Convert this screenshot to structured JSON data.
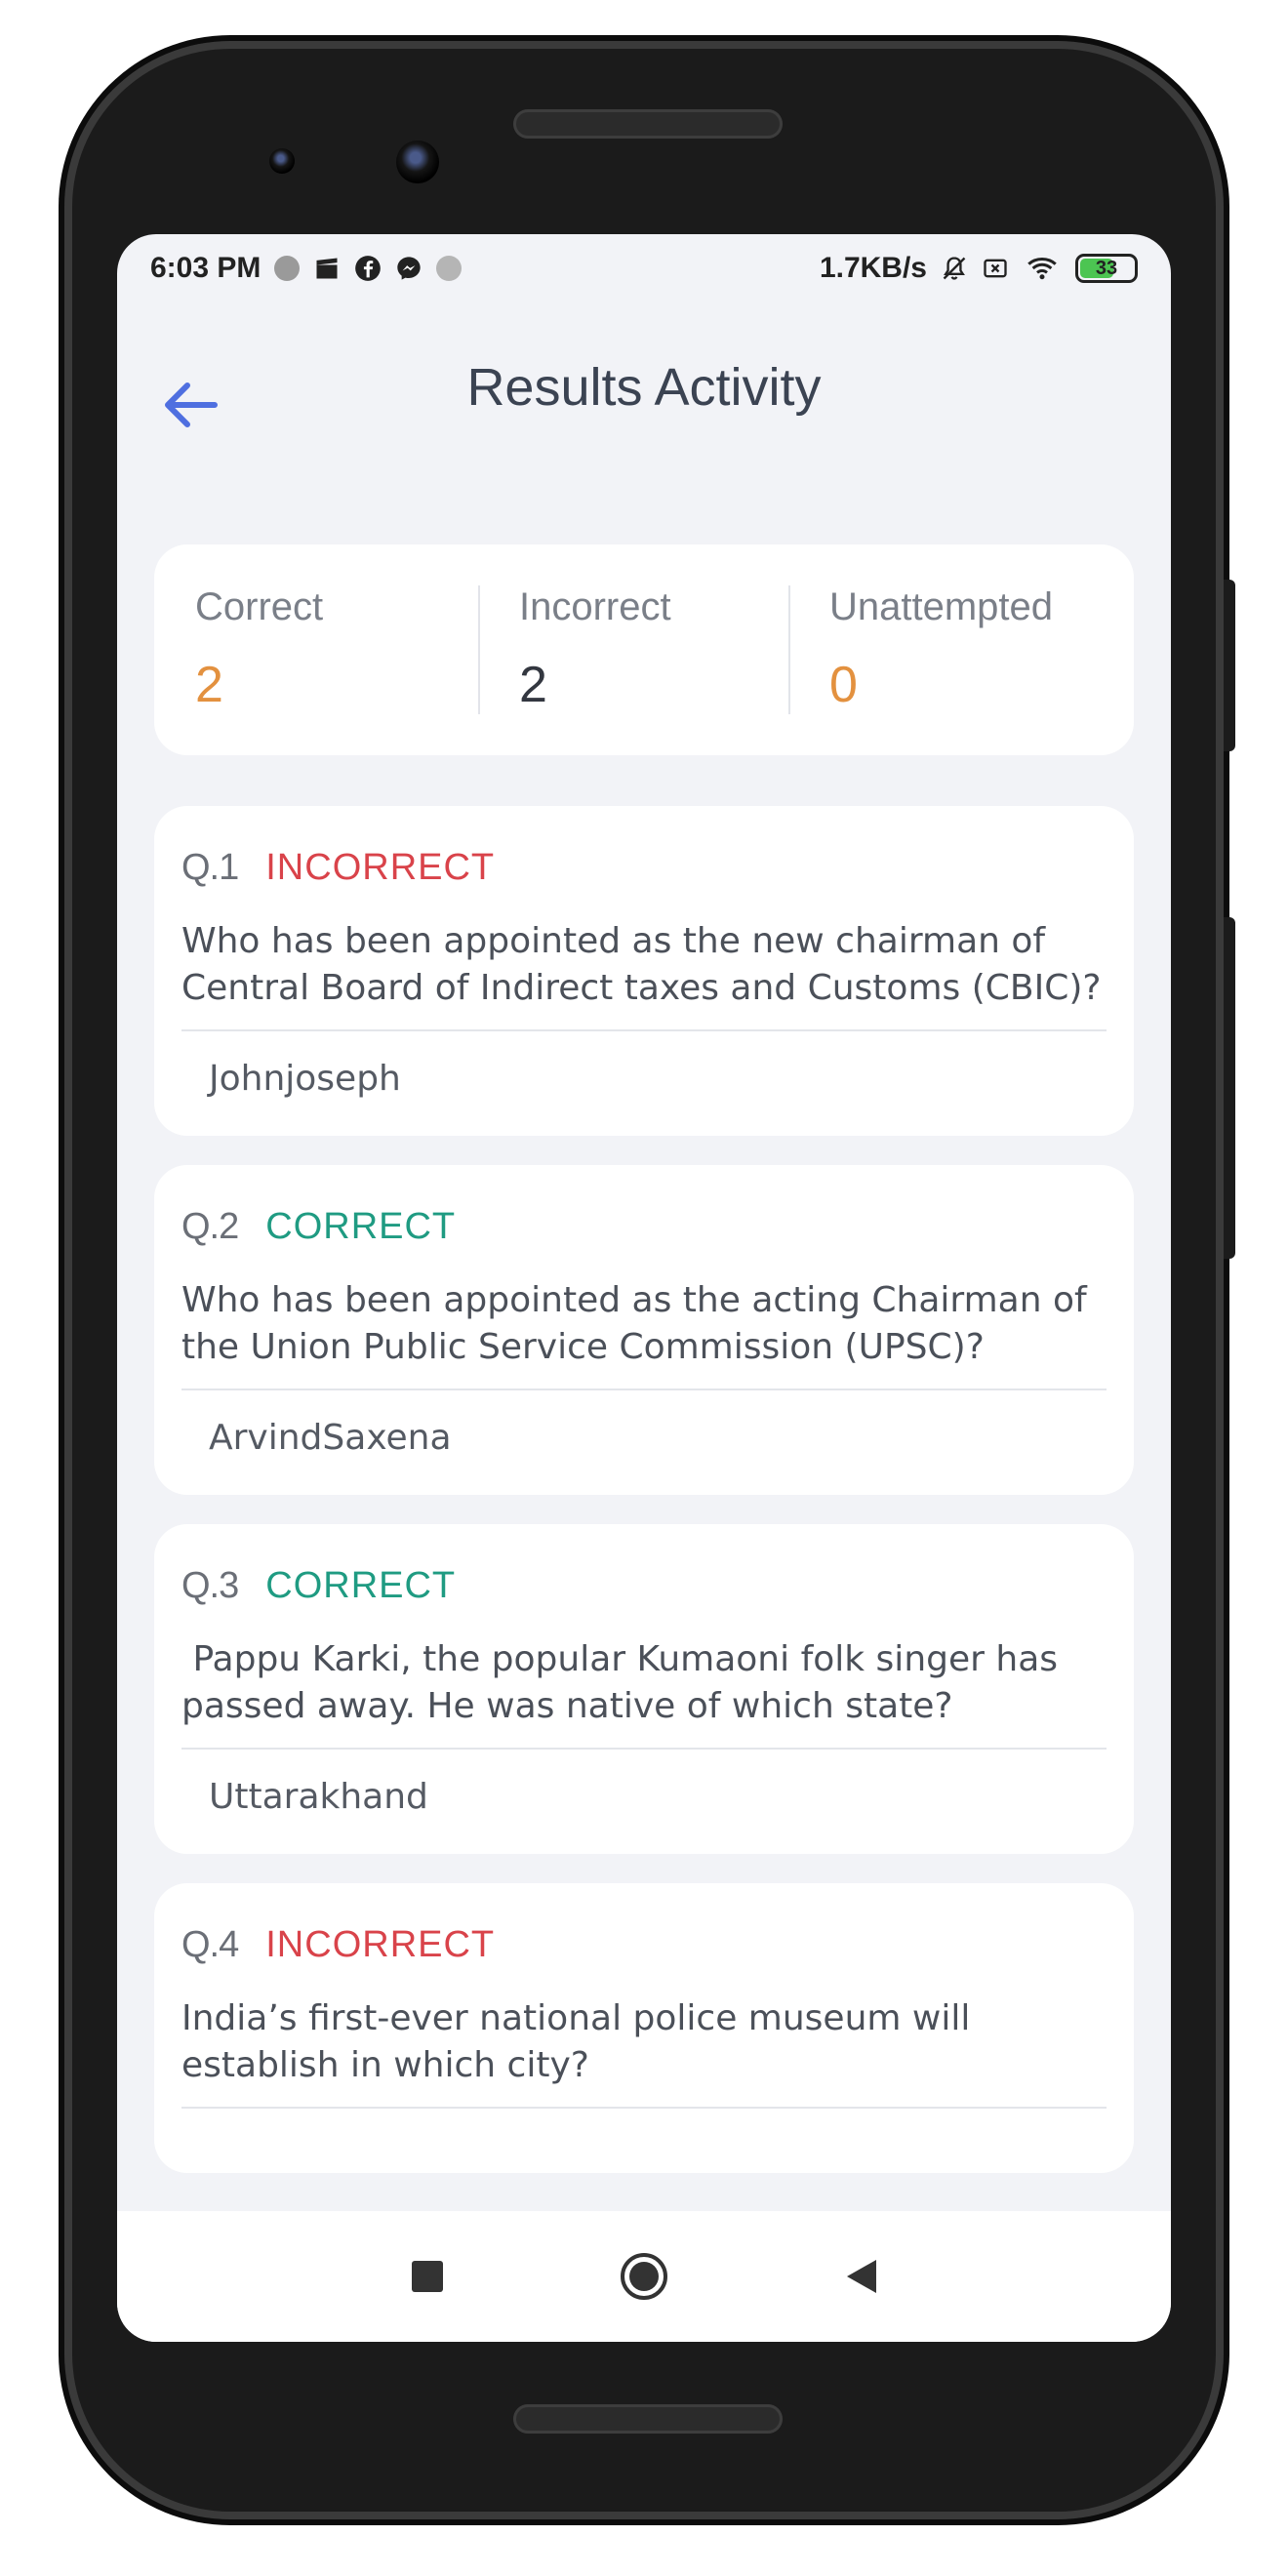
{
  "status_bar": {
    "time": "6:03 PM",
    "network_speed": "1.7KB/s",
    "battery_level": "33",
    "icons": [
      "notification-dot-icon",
      "clapper-icon",
      "facebook-icon",
      "messenger-icon",
      "notification-dot-icon",
      "mute-bell-icon",
      "sim-off-icon",
      "wifi-icon",
      "battery-icon"
    ]
  },
  "header": {
    "title": "Results Activity",
    "back_icon": "arrow-left-icon"
  },
  "summary": {
    "correct_label": "Correct",
    "correct_value": "2",
    "incorrect_label": "Incorrect",
    "incorrect_value": "2",
    "unattempted_label": "Unattempted",
    "unattempted_value": "0"
  },
  "questions": [
    {
      "number": "Q.1",
      "status": "INCORRECT",
      "text": "Who has been appointed as the new chairman of Central Board of Indirect taxes and Customs (CBIC)?",
      "answer": "Johnjoseph"
    },
    {
      "number": "Q.2",
      "status": "CORRECT",
      "text": "Who has been appointed as the acting Chairman of the Union Public Service Commission (UPSC)?",
      "answer": "ArvindSaxena"
    },
    {
      "number": "Q.3",
      "status": "CORRECT",
      "text": " Pappu Karki, the popular Kumaoni folk singer has passed away. He was native of which state?",
      "answer": "Uttarakhand"
    },
    {
      "number": "Q.4",
      "status": "INCORRECT",
      "text": "India’s first-ever national police museum will establish in which city?",
      "answer": ""
    }
  ],
  "nav_bar": {
    "icons": [
      "recent-apps-icon",
      "home-icon",
      "back-icon"
    ]
  },
  "colors": {
    "accent_blue": "#4f6fe0",
    "correct_orange": "#e3913f",
    "correct_green": "#1f9b82",
    "incorrect_red": "#d9434a",
    "neutral_dark": "#333740",
    "background": "#f2f3f7"
  }
}
